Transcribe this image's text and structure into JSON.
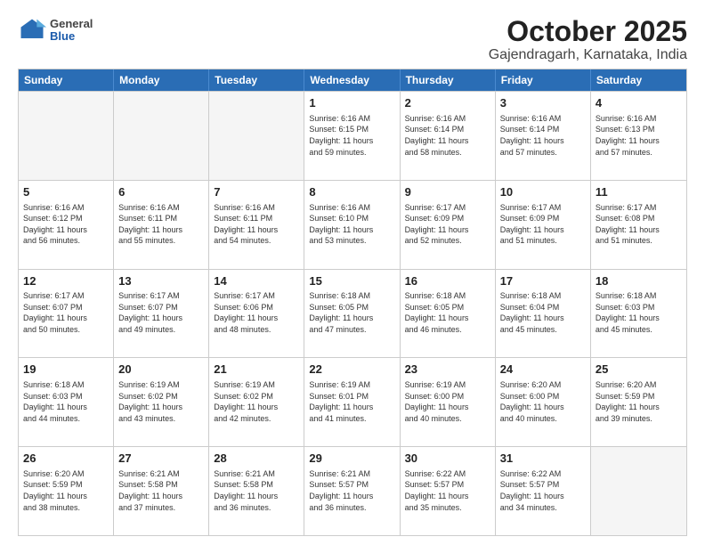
{
  "logo": {
    "general": "General",
    "blue": "Blue"
  },
  "header": {
    "month": "October 2025",
    "location": "Gajendragarh, Karnataka, India"
  },
  "weekdays": [
    "Sunday",
    "Monday",
    "Tuesday",
    "Wednesday",
    "Thursday",
    "Friday",
    "Saturday"
  ],
  "weeks": [
    [
      {
        "day": "",
        "info": "",
        "empty": true
      },
      {
        "day": "",
        "info": "",
        "empty": true
      },
      {
        "day": "",
        "info": "",
        "empty": true
      },
      {
        "day": "1",
        "info": "Sunrise: 6:16 AM\nSunset: 6:15 PM\nDaylight: 11 hours\nand 59 minutes.",
        "empty": false
      },
      {
        "day": "2",
        "info": "Sunrise: 6:16 AM\nSunset: 6:14 PM\nDaylight: 11 hours\nand 58 minutes.",
        "empty": false
      },
      {
        "day": "3",
        "info": "Sunrise: 6:16 AM\nSunset: 6:14 PM\nDaylight: 11 hours\nand 57 minutes.",
        "empty": false
      },
      {
        "day": "4",
        "info": "Sunrise: 6:16 AM\nSunset: 6:13 PM\nDaylight: 11 hours\nand 57 minutes.",
        "empty": false
      }
    ],
    [
      {
        "day": "5",
        "info": "Sunrise: 6:16 AM\nSunset: 6:12 PM\nDaylight: 11 hours\nand 56 minutes.",
        "empty": false
      },
      {
        "day": "6",
        "info": "Sunrise: 6:16 AM\nSunset: 6:11 PM\nDaylight: 11 hours\nand 55 minutes.",
        "empty": false
      },
      {
        "day": "7",
        "info": "Sunrise: 6:16 AM\nSunset: 6:11 PM\nDaylight: 11 hours\nand 54 minutes.",
        "empty": false
      },
      {
        "day": "8",
        "info": "Sunrise: 6:16 AM\nSunset: 6:10 PM\nDaylight: 11 hours\nand 53 minutes.",
        "empty": false
      },
      {
        "day": "9",
        "info": "Sunrise: 6:17 AM\nSunset: 6:09 PM\nDaylight: 11 hours\nand 52 minutes.",
        "empty": false
      },
      {
        "day": "10",
        "info": "Sunrise: 6:17 AM\nSunset: 6:09 PM\nDaylight: 11 hours\nand 51 minutes.",
        "empty": false
      },
      {
        "day": "11",
        "info": "Sunrise: 6:17 AM\nSunset: 6:08 PM\nDaylight: 11 hours\nand 51 minutes.",
        "empty": false
      }
    ],
    [
      {
        "day": "12",
        "info": "Sunrise: 6:17 AM\nSunset: 6:07 PM\nDaylight: 11 hours\nand 50 minutes.",
        "empty": false
      },
      {
        "day": "13",
        "info": "Sunrise: 6:17 AM\nSunset: 6:07 PM\nDaylight: 11 hours\nand 49 minutes.",
        "empty": false
      },
      {
        "day": "14",
        "info": "Sunrise: 6:17 AM\nSunset: 6:06 PM\nDaylight: 11 hours\nand 48 minutes.",
        "empty": false
      },
      {
        "day": "15",
        "info": "Sunrise: 6:18 AM\nSunset: 6:05 PM\nDaylight: 11 hours\nand 47 minutes.",
        "empty": false
      },
      {
        "day": "16",
        "info": "Sunrise: 6:18 AM\nSunset: 6:05 PM\nDaylight: 11 hours\nand 46 minutes.",
        "empty": false
      },
      {
        "day": "17",
        "info": "Sunrise: 6:18 AM\nSunset: 6:04 PM\nDaylight: 11 hours\nand 45 minutes.",
        "empty": false
      },
      {
        "day": "18",
        "info": "Sunrise: 6:18 AM\nSunset: 6:03 PM\nDaylight: 11 hours\nand 45 minutes.",
        "empty": false
      }
    ],
    [
      {
        "day": "19",
        "info": "Sunrise: 6:18 AM\nSunset: 6:03 PM\nDaylight: 11 hours\nand 44 minutes.",
        "empty": false
      },
      {
        "day": "20",
        "info": "Sunrise: 6:19 AM\nSunset: 6:02 PM\nDaylight: 11 hours\nand 43 minutes.",
        "empty": false
      },
      {
        "day": "21",
        "info": "Sunrise: 6:19 AM\nSunset: 6:02 PM\nDaylight: 11 hours\nand 42 minutes.",
        "empty": false
      },
      {
        "day": "22",
        "info": "Sunrise: 6:19 AM\nSunset: 6:01 PM\nDaylight: 11 hours\nand 41 minutes.",
        "empty": false
      },
      {
        "day": "23",
        "info": "Sunrise: 6:19 AM\nSunset: 6:00 PM\nDaylight: 11 hours\nand 40 minutes.",
        "empty": false
      },
      {
        "day": "24",
        "info": "Sunrise: 6:20 AM\nSunset: 6:00 PM\nDaylight: 11 hours\nand 40 minutes.",
        "empty": false
      },
      {
        "day": "25",
        "info": "Sunrise: 6:20 AM\nSunset: 5:59 PM\nDaylight: 11 hours\nand 39 minutes.",
        "empty": false
      }
    ],
    [
      {
        "day": "26",
        "info": "Sunrise: 6:20 AM\nSunset: 5:59 PM\nDaylight: 11 hours\nand 38 minutes.",
        "empty": false
      },
      {
        "day": "27",
        "info": "Sunrise: 6:21 AM\nSunset: 5:58 PM\nDaylight: 11 hours\nand 37 minutes.",
        "empty": false
      },
      {
        "day": "28",
        "info": "Sunrise: 6:21 AM\nSunset: 5:58 PM\nDaylight: 11 hours\nand 36 minutes.",
        "empty": false
      },
      {
        "day": "29",
        "info": "Sunrise: 6:21 AM\nSunset: 5:57 PM\nDaylight: 11 hours\nand 36 minutes.",
        "empty": false
      },
      {
        "day": "30",
        "info": "Sunrise: 6:22 AM\nSunset: 5:57 PM\nDaylight: 11 hours\nand 35 minutes.",
        "empty": false
      },
      {
        "day": "31",
        "info": "Sunrise: 6:22 AM\nSunset: 5:57 PM\nDaylight: 11 hours\nand 34 minutes.",
        "empty": false
      },
      {
        "day": "",
        "info": "",
        "empty": true
      }
    ]
  ]
}
